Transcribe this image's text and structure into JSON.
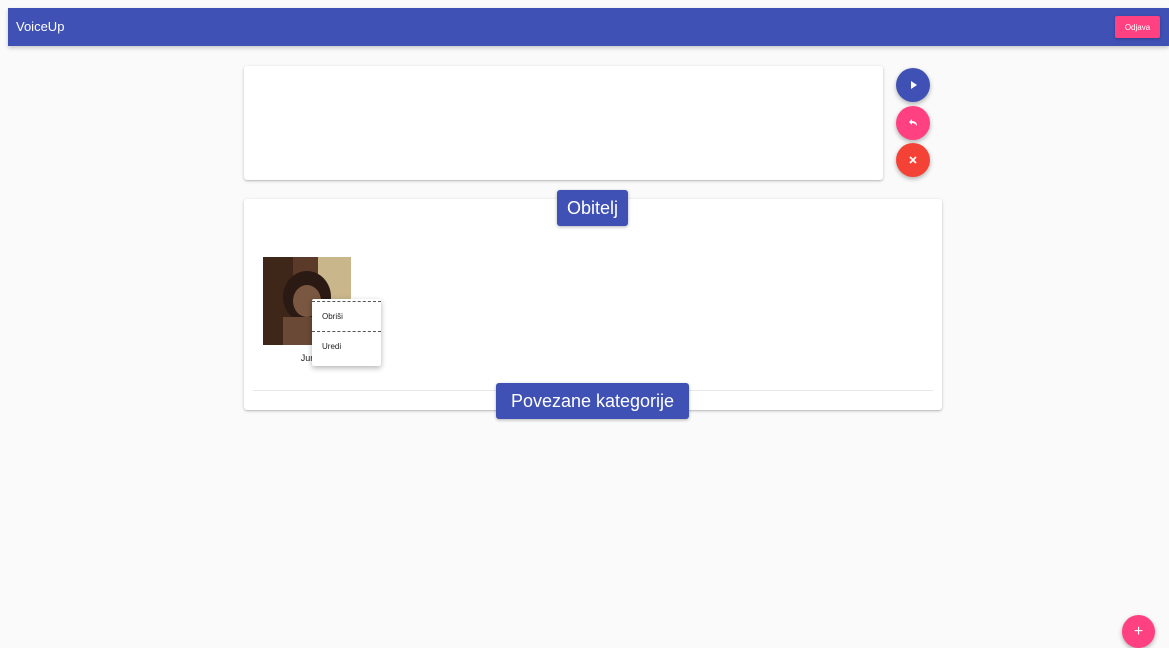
{
  "app": {
    "title": "VoiceUp"
  },
  "toolbar": {
    "logout_label": "Odjava"
  },
  "actions": {
    "play_icon": "play-icon",
    "undo_icon": "undo-icon",
    "clear_icon": "close-icon",
    "add_label": "+"
  },
  "category": {
    "title": "Obitelj",
    "related_title": "Povezane kategorije",
    "cards": [
      {
        "label": "Jur"
      }
    ]
  },
  "context_menu": {
    "delete_label": "Obriši",
    "edit_label": "Uredi"
  },
  "colors": {
    "primary": "#3f51b5",
    "accent": "#ff4081",
    "warn": "#f44336"
  }
}
